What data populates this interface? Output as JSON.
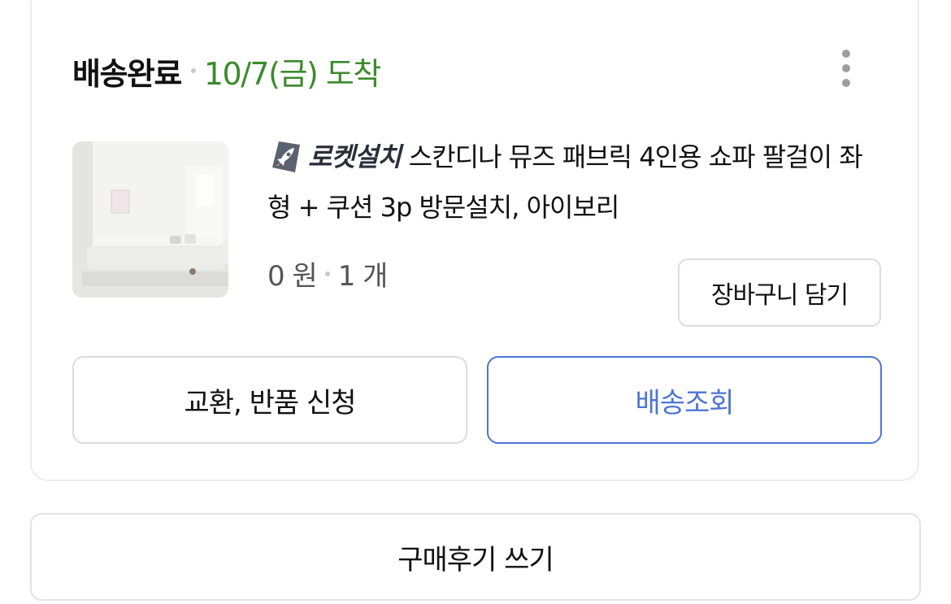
{
  "order": {
    "status": "배송완료",
    "arrival": "10/7(금) 도착",
    "more_menu_icon": "more-vertical-icon"
  },
  "product": {
    "image_alt": "white fabric sofa in bright living room",
    "badge_icon": "rocket-install-icon",
    "badge_label": "로켓설치",
    "name": "스칸디나 뮤즈 패브릭 4인용 쇼파 팔걸이 좌형 + 쿠션 3p 방문설치, 아이보리",
    "price": "0 원",
    "quantity": "1 개"
  },
  "actions": {
    "add_to_cart": "장바구니 담기",
    "exchange_return": "교환, 반품 신청",
    "track_delivery": "배송조회",
    "write_review": "구매후기 쓰기"
  },
  "colors": {
    "arrival_green": "#3d8a2c",
    "primary_blue": "#4e74d6"
  }
}
